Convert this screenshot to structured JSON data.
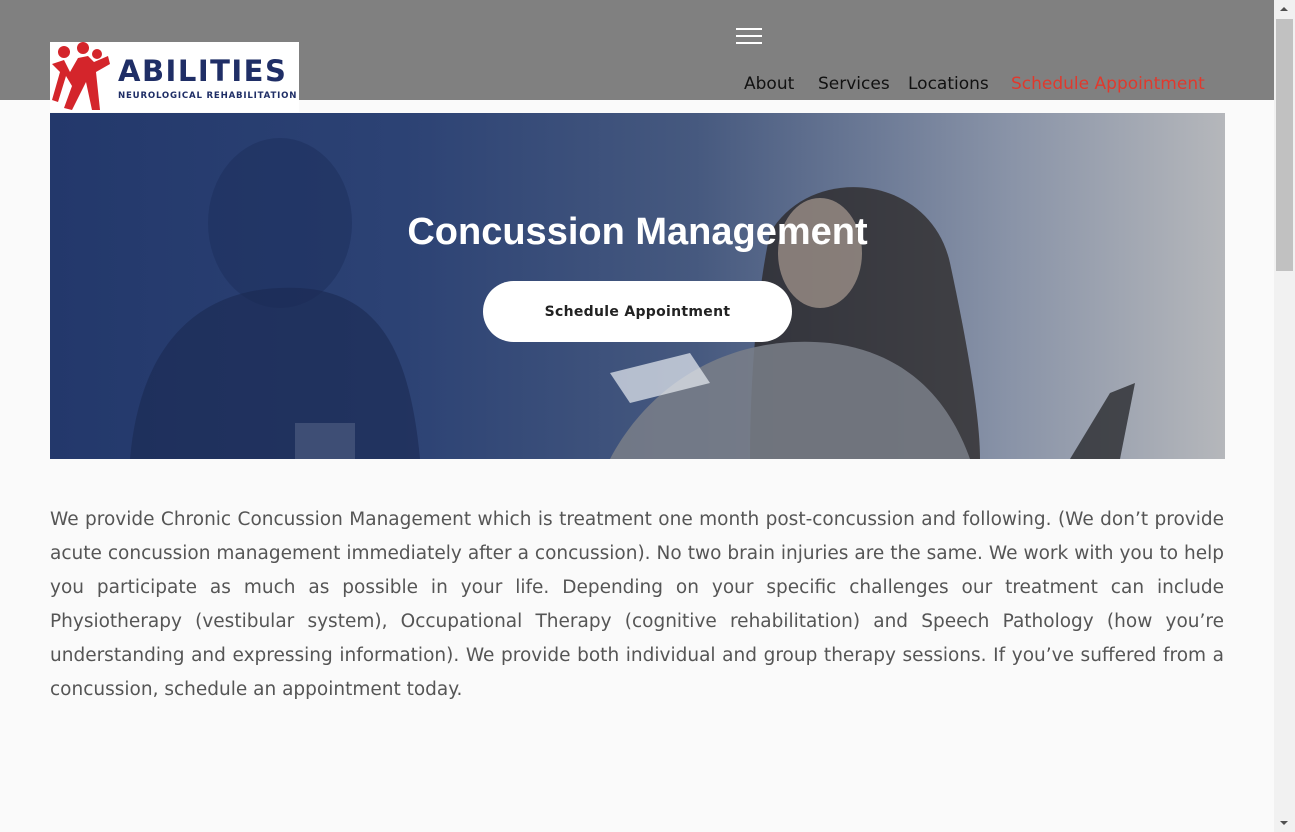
{
  "header": {
    "logo": {
      "wordmark": "ABILITIES",
      "tagline": "NEUROLOGICAL REHABILITATION",
      "brand_red": "#d4252b",
      "brand_navy": "#1f2e66"
    },
    "menu_icon": "hamburger-icon",
    "nav": [
      {
        "label": "About",
        "has_dropdown": true
      },
      {
        "label": "Services",
        "has_dropdown": false
      },
      {
        "label": "Locations",
        "has_dropdown": true
      },
      {
        "label": "Schedule Appointment",
        "has_dropdown": false
      }
    ],
    "accent_color": "#e0392d",
    "bar_color": "#808080"
  },
  "hero": {
    "title": "Concussion Management",
    "button_label": "Schedule Appointment",
    "overlay_color": "#23386b"
  },
  "content": {
    "body": "We provide Chronic Concussion Management which is treatment one month post-concussion and following. (We don’t provide acute concussion management immediately after a concussion). No two brain injuries are the same. We work with you to help you participate as much as possible in your life. Depending on your specific challenges our treatment can include Physiotherapy (vestibular system), Occupational Therapy (cognitive rehabilitation) and Speech Pathology (how you’re understanding and expressing information). We provide both individual and group therapy sessions. If you’ve suffered from a concussion, schedule an appointment today."
  },
  "scrollbar": {
    "up_icon": "arrow-up-icon",
    "down_icon": "arrow-down-icon"
  }
}
